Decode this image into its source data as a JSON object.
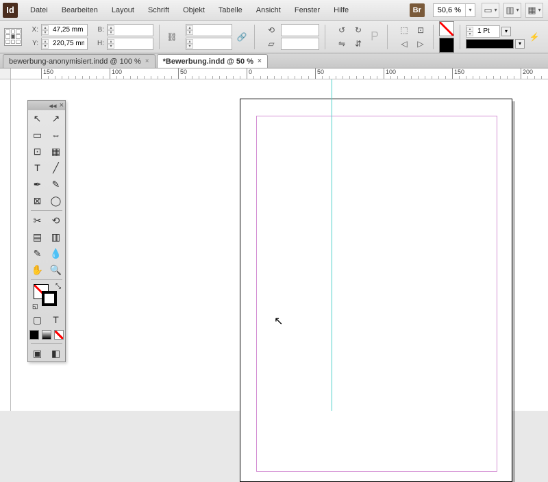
{
  "app": {
    "logo": "Id",
    "bridge": "Br"
  },
  "menu": {
    "file": "Datei",
    "edit": "Bearbeiten",
    "layout": "Layout",
    "type": "Schrift",
    "object": "Objekt",
    "table": "Tabelle",
    "view": "Ansicht",
    "window": "Fenster",
    "help": "Hilfe"
  },
  "zoom": {
    "value": "50,6 %"
  },
  "control": {
    "x_label": "X:",
    "x_value": "47,25 mm",
    "y_label": "Y:",
    "y_value": "220,75 mm",
    "w_label": "B:",
    "w_value": "",
    "h_label": "H:",
    "h_value": "",
    "stroke_weight": "1 Pt"
  },
  "tabs": [
    {
      "label": "bewerbung-anonymisiert.indd @ 100 %",
      "active": false
    },
    {
      "label": "*Bewerbung.indd @ 50 %",
      "active": true
    }
  ],
  "ruler": {
    "h_labels": [
      "150",
      "100",
      "50",
      "0",
      "50",
      "100",
      "150",
      "200"
    ],
    "h_positions": [
      60,
      160,
      260,
      360,
      460,
      560,
      660,
      760
    ]
  },
  "tools": {
    "selection": "↖",
    "direct": "↗",
    "page": "▭",
    "gap": "⇔",
    "content": "⊡",
    "content2": "▦",
    "type": "T",
    "line": "╱",
    "pen": "✒",
    "pencil": "✎",
    "frame": "⊠",
    "ellipse": "◯",
    "scissors": "✂",
    "transform": "⟲",
    "gradient": "▤",
    "gradient2": "▥",
    "note": "✎",
    "eyedrop": "💧",
    "hand": "✋",
    "zoom": "🔍",
    "container": "▢",
    "text_mode": "T",
    "view1": "▣",
    "view2": "◧"
  },
  "colors": {
    "guide": "#4dd0c8",
    "margin": "#d490d4"
  }
}
